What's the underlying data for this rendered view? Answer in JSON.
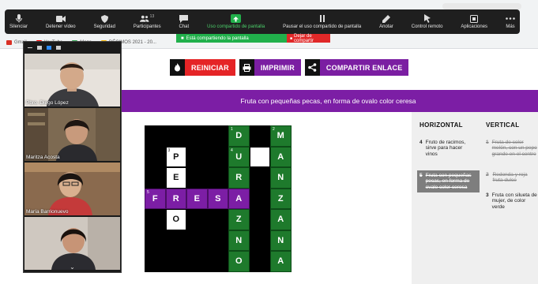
{
  "browser": {
    "bookmarks": [
      {
        "label": "Gmail",
        "color": "#d93025"
      },
      {
        "label": "YouTube",
        "color": "#ff0000"
      },
      {
        "label": "Maps",
        "color": "#34a853"
      },
      {
        "label": "DÉCIMOS 2021 - 20...",
        "color": "#f4b400"
      }
    ]
  },
  "zoom_toolbar": {
    "items": [
      {
        "label": "Silenciar",
        "icon": "microphone-icon"
      },
      {
        "label": "Detener vídeo",
        "icon": "video-camera-icon"
      },
      {
        "label": "Seguridad",
        "icon": "shield-icon"
      },
      {
        "label": "Participantes",
        "icon": "participants-icon",
        "count": "13"
      },
      {
        "label": "Chat",
        "icon": "chat-icon"
      },
      {
        "label": "Uso compartido de pantalla",
        "icon": "share-screen-icon"
      },
      {
        "label": "Pausar el uso compartido de pantalla",
        "icon": "pause-icon"
      },
      {
        "label": "Anotar",
        "icon": "pen-icon"
      },
      {
        "label": "Control remoto",
        "icon": "remote-control-icon"
      },
      {
        "label": "Aplicaciones",
        "icon": "apps-icon"
      },
      {
        "label": "Más",
        "icon": "more-icon"
      }
    ]
  },
  "share_banner": {
    "status": "Está compartiendo la pantalla",
    "stop": "Dejar de compartir"
  },
  "actions": {
    "reiniciar": "REINICIAR",
    "imprimir": "IMPRIMIR",
    "compartir": "COMPARTIR ENLACE"
  },
  "current_clue": "Fruta con pequeñas pecas, en forma de ovalo color ceresa",
  "crossword": {
    "rows": [
      [
        {
          "t": "b"
        },
        {
          "t": "b"
        },
        {
          "t": "b"
        },
        {
          "t": "b"
        },
        {
          "t": "g",
          "l": "D",
          "n": "1"
        },
        {
          "t": "b"
        },
        {
          "t": "g",
          "l": "M",
          "n": "2"
        }
      ],
      [
        {
          "t": "b"
        },
        {
          "t": "w",
          "l": "P",
          "n": "3"
        },
        {
          "t": "b"
        },
        {
          "t": "b"
        },
        {
          "t": "g",
          "l": "U",
          "n": "4"
        },
        {
          "t": "w"
        },
        {
          "t": "g",
          "l": "A"
        }
      ],
      [
        {
          "t": "b"
        },
        {
          "t": "w",
          "l": "E"
        },
        {
          "t": "b"
        },
        {
          "t": "b"
        },
        {
          "t": "g",
          "l": "R"
        },
        {
          "t": "b"
        },
        {
          "t": "g",
          "l": "N"
        }
      ],
      [
        {
          "t": "p",
          "l": "F",
          "n": "5"
        },
        {
          "t": "p",
          "l": "R"
        },
        {
          "t": "p",
          "l": "E"
        },
        {
          "t": "p",
          "l": "S"
        },
        {
          "t": "p",
          "l": "A"
        },
        {
          "t": "b"
        },
        {
          "t": "g",
          "l": "Z"
        }
      ],
      [
        {
          "t": "b"
        },
        {
          "t": "w",
          "l": "O"
        },
        {
          "t": "b"
        },
        {
          "t": "b"
        },
        {
          "t": "g",
          "l": "Z"
        },
        {
          "t": "b"
        },
        {
          "t": "g",
          "l": "A"
        }
      ],
      [
        {
          "t": "b"
        },
        {
          "t": "b"
        },
        {
          "t": "b"
        },
        {
          "t": "b"
        },
        {
          "t": "g",
          "l": "N"
        },
        {
          "t": "b"
        },
        {
          "t": "g",
          "l": "N"
        }
      ],
      [
        {
          "t": "b"
        },
        {
          "t": "b"
        },
        {
          "t": "b"
        },
        {
          "t": "b"
        },
        {
          "t": "g",
          "l": "O"
        },
        {
          "t": "b"
        },
        {
          "t": "g",
          "l": "A"
        }
      ]
    ]
  },
  "clues": {
    "horizontal_title": "HORIZONTAL",
    "vertical_title": "VERTICAL",
    "horizontal": [
      {
        "num": "4",
        "text": "Fruto de racimos, sirve para hacer vinos",
        "state": "normal"
      },
      {
        "num": "5",
        "text": "Fruta con pequeñas pecas, en forma de ovalo color ceresa",
        "state": "active"
      }
    ],
    "vertical": [
      {
        "num": "1",
        "text": "Fruta de color melón, con un pepo grande en el centro",
        "state": "done"
      },
      {
        "num": "2",
        "text": "Redonda y roja fruta dulce",
        "state": "done"
      },
      {
        "num": "3",
        "text": "Fruta con silueta de mujer, de color verde",
        "state": "normal"
      }
    ]
  },
  "participants": [
    {
      "name": "Pbro. Diego López"
    },
    {
      "name": "Maritza Acosta"
    },
    {
      "name": "María Barrionuevo"
    },
    {
      "name": ""
    }
  ]
}
